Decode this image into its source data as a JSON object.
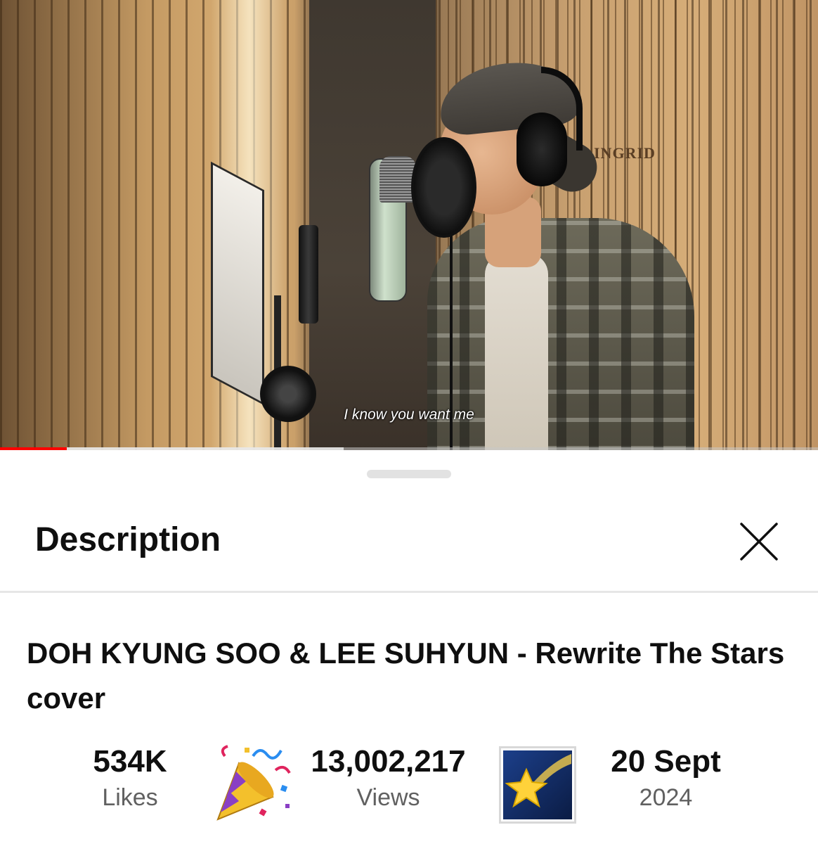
{
  "video": {
    "subtitle": "I know you want me",
    "studio_logo": "INGRID",
    "progress_played_fraction": 0.082,
    "progress_buffered_fraction": 0.42,
    "progress_color": "#ff0000"
  },
  "description_sheet": {
    "title": "Description",
    "close_icon": "close-icon",
    "video_title": "DOH KYUNG SOO & LEE SUHYUN - Rewrite The Stars cover",
    "stats": {
      "likes_value": "534K",
      "likes_label": "Likes",
      "likes_emoji": "party-popper-icon",
      "views_value": "13,002,217",
      "views_label": "Views",
      "views_emoji": "shooting-star-icon",
      "date_value": "20 Sept",
      "date_label": "2024"
    }
  }
}
